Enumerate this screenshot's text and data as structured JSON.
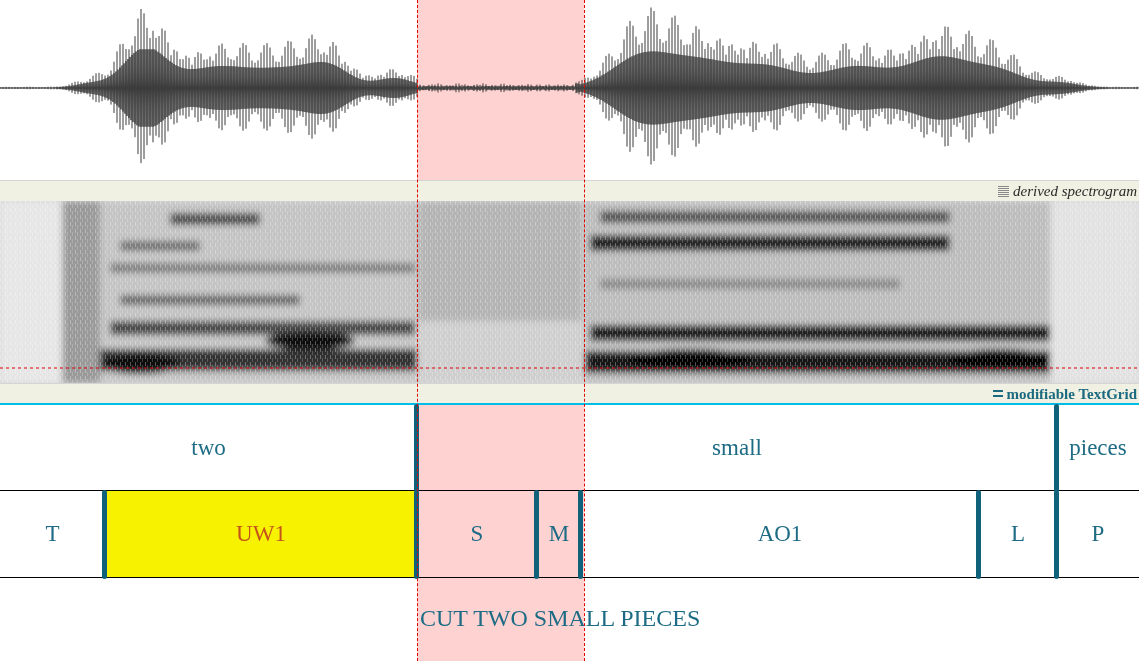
{
  "spectrogram": {
    "label": "derived spectrogram"
  },
  "textgrid": {
    "label": "modifiable TextGrid",
    "tiers": [
      {
        "intervals": [
          {
            "text": "two",
            "selected": false
          },
          {
            "text": "small",
            "selected": false
          },
          {
            "text": "pieces",
            "selected": false
          }
        ]
      },
      {
        "intervals": [
          {
            "text": "T",
            "selected": false
          },
          {
            "text": "UW1",
            "selected": true
          },
          {
            "text": "S",
            "selected": false
          },
          {
            "text": "M",
            "selected": false
          },
          {
            "text": "AO1",
            "selected": false
          },
          {
            "text": "L",
            "selected": false
          },
          {
            "text": "P",
            "selected": false
          }
        ]
      }
    ]
  },
  "transcript": "CUT TWO SMALL PIECES"
}
